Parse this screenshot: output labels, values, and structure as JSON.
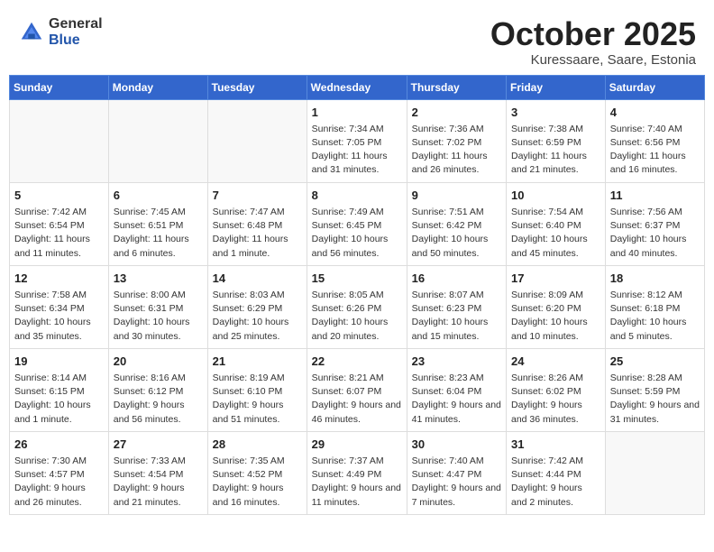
{
  "header": {
    "logo_general": "General",
    "logo_blue": "Blue",
    "month_title": "October 2025",
    "location": "Kuressaare, Saare, Estonia"
  },
  "weekdays": [
    "Sunday",
    "Monday",
    "Tuesday",
    "Wednesday",
    "Thursday",
    "Friday",
    "Saturday"
  ],
  "weeks": [
    [
      {
        "day": "",
        "sunrise": "",
        "sunset": "",
        "daylight": ""
      },
      {
        "day": "",
        "sunrise": "",
        "sunset": "",
        "daylight": ""
      },
      {
        "day": "",
        "sunrise": "",
        "sunset": "",
        "daylight": ""
      },
      {
        "day": "1",
        "sunrise": "Sunrise: 7:34 AM",
        "sunset": "Sunset: 7:05 PM",
        "daylight": "Daylight: 11 hours and 31 minutes."
      },
      {
        "day": "2",
        "sunrise": "Sunrise: 7:36 AM",
        "sunset": "Sunset: 7:02 PM",
        "daylight": "Daylight: 11 hours and 26 minutes."
      },
      {
        "day": "3",
        "sunrise": "Sunrise: 7:38 AM",
        "sunset": "Sunset: 6:59 PM",
        "daylight": "Daylight: 11 hours and 21 minutes."
      },
      {
        "day": "4",
        "sunrise": "Sunrise: 7:40 AM",
        "sunset": "Sunset: 6:56 PM",
        "daylight": "Daylight: 11 hours and 16 minutes."
      }
    ],
    [
      {
        "day": "5",
        "sunrise": "Sunrise: 7:42 AM",
        "sunset": "Sunset: 6:54 PM",
        "daylight": "Daylight: 11 hours and 11 minutes."
      },
      {
        "day": "6",
        "sunrise": "Sunrise: 7:45 AM",
        "sunset": "Sunset: 6:51 PM",
        "daylight": "Daylight: 11 hours and 6 minutes."
      },
      {
        "day": "7",
        "sunrise": "Sunrise: 7:47 AM",
        "sunset": "Sunset: 6:48 PM",
        "daylight": "Daylight: 11 hours and 1 minute."
      },
      {
        "day": "8",
        "sunrise": "Sunrise: 7:49 AM",
        "sunset": "Sunset: 6:45 PM",
        "daylight": "Daylight: 10 hours and 56 minutes."
      },
      {
        "day": "9",
        "sunrise": "Sunrise: 7:51 AM",
        "sunset": "Sunset: 6:42 PM",
        "daylight": "Daylight: 10 hours and 50 minutes."
      },
      {
        "day": "10",
        "sunrise": "Sunrise: 7:54 AM",
        "sunset": "Sunset: 6:40 PM",
        "daylight": "Daylight: 10 hours and 45 minutes."
      },
      {
        "day": "11",
        "sunrise": "Sunrise: 7:56 AM",
        "sunset": "Sunset: 6:37 PM",
        "daylight": "Daylight: 10 hours and 40 minutes."
      }
    ],
    [
      {
        "day": "12",
        "sunrise": "Sunrise: 7:58 AM",
        "sunset": "Sunset: 6:34 PM",
        "daylight": "Daylight: 10 hours and 35 minutes."
      },
      {
        "day": "13",
        "sunrise": "Sunrise: 8:00 AM",
        "sunset": "Sunset: 6:31 PM",
        "daylight": "Daylight: 10 hours and 30 minutes."
      },
      {
        "day": "14",
        "sunrise": "Sunrise: 8:03 AM",
        "sunset": "Sunset: 6:29 PM",
        "daylight": "Daylight: 10 hours and 25 minutes."
      },
      {
        "day": "15",
        "sunrise": "Sunrise: 8:05 AM",
        "sunset": "Sunset: 6:26 PM",
        "daylight": "Daylight: 10 hours and 20 minutes."
      },
      {
        "day": "16",
        "sunrise": "Sunrise: 8:07 AM",
        "sunset": "Sunset: 6:23 PM",
        "daylight": "Daylight: 10 hours and 15 minutes."
      },
      {
        "day": "17",
        "sunrise": "Sunrise: 8:09 AM",
        "sunset": "Sunset: 6:20 PM",
        "daylight": "Daylight: 10 hours and 10 minutes."
      },
      {
        "day": "18",
        "sunrise": "Sunrise: 8:12 AM",
        "sunset": "Sunset: 6:18 PM",
        "daylight": "Daylight: 10 hours and 5 minutes."
      }
    ],
    [
      {
        "day": "19",
        "sunrise": "Sunrise: 8:14 AM",
        "sunset": "Sunset: 6:15 PM",
        "daylight": "Daylight: 10 hours and 1 minute."
      },
      {
        "day": "20",
        "sunrise": "Sunrise: 8:16 AM",
        "sunset": "Sunset: 6:12 PM",
        "daylight": "Daylight: 9 hours and 56 minutes."
      },
      {
        "day": "21",
        "sunrise": "Sunrise: 8:19 AM",
        "sunset": "Sunset: 6:10 PM",
        "daylight": "Daylight: 9 hours and 51 minutes."
      },
      {
        "day": "22",
        "sunrise": "Sunrise: 8:21 AM",
        "sunset": "Sunset: 6:07 PM",
        "daylight": "Daylight: 9 hours and 46 minutes."
      },
      {
        "day": "23",
        "sunrise": "Sunrise: 8:23 AM",
        "sunset": "Sunset: 6:04 PM",
        "daylight": "Daylight: 9 hours and 41 minutes."
      },
      {
        "day": "24",
        "sunrise": "Sunrise: 8:26 AM",
        "sunset": "Sunset: 6:02 PM",
        "daylight": "Daylight: 9 hours and 36 minutes."
      },
      {
        "day": "25",
        "sunrise": "Sunrise: 8:28 AM",
        "sunset": "Sunset: 5:59 PM",
        "daylight": "Daylight: 9 hours and 31 minutes."
      }
    ],
    [
      {
        "day": "26",
        "sunrise": "Sunrise: 7:30 AM",
        "sunset": "Sunset: 4:57 PM",
        "daylight": "Daylight: 9 hours and 26 minutes."
      },
      {
        "day": "27",
        "sunrise": "Sunrise: 7:33 AM",
        "sunset": "Sunset: 4:54 PM",
        "daylight": "Daylight: 9 hours and 21 minutes."
      },
      {
        "day": "28",
        "sunrise": "Sunrise: 7:35 AM",
        "sunset": "Sunset: 4:52 PM",
        "daylight": "Daylight: 9 hours and 16 minutes."
      },
      {
        "day": "29",
        "sunrise": "Sunrise: 7:37 AM",
        "sunset": "Sunset: 4:49 PM",
        "daylight": "Daylight: 9 hours and 11 minutes."
      },
      {
        "day": "30",
        "sunrise": "Sunrise: 7:40 AM",
        "sunset": "Sunset: 4:47 PM",
        "daylight": "Daylight: 9 hours and 7 minutes."
      },
      {
        "day": "31",
        "sunrise": "Sunrise: 7:42 AM",
        "sunset": "Sunset: 4:44 PM",
        "daylight": "Daylight: 9 hours and 2 minutes."
      },
      {
        "day": "",
        "sunrise": "",
        "sunset": "",
        "daylight": ""
      }
    ]
  ]
}
